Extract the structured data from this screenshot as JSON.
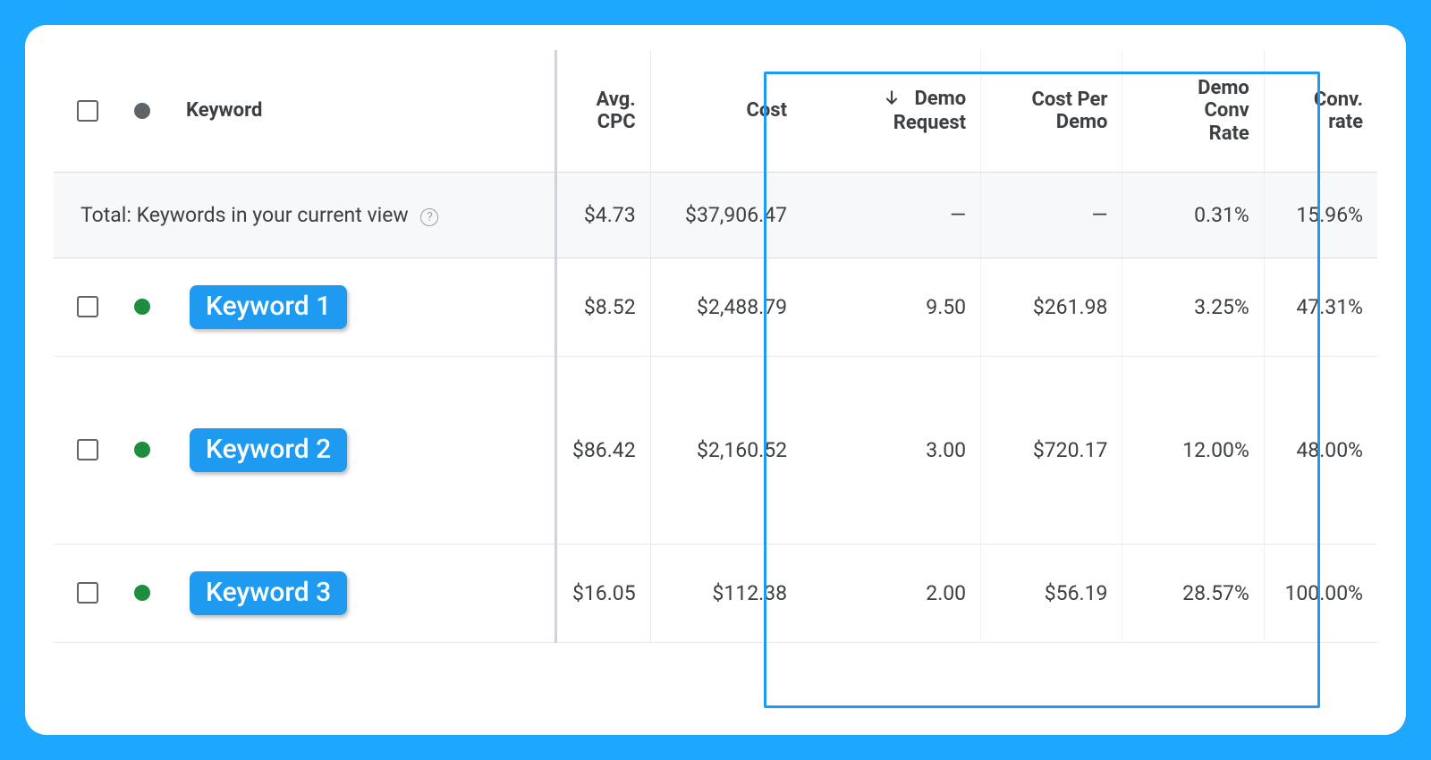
{
  "columns": {
    "keyword": "Keyword",
    "avg_cpc_l1": "Avg.",
    "avg_cpc_l2": "CPC",
    "cost": "Cost",
    "demo_req_l1": "Demo",
    "demo_req_l2": "Request",
    "cpd_l1": "Cost Per",
    "cpd_l2": "Demo",
    "dcr_l1": "Demo",
    "dcr_l2": "Conv",
    "dcr_l3": "Rate",
    "crate_l1": "Conv.",
    "crate_l2": "rate"
  },
  "total": {
    "label": "Total: Keywords in your current view",
    "avg_cpc": "$4.73",
    "cost": "$37,906.47",
    "demo_req": "—",
    "cpd": "—",
    "dcr": "0.31%",
    "crate": "15.96%"
  },
  "rows": [
    {
      "keyword": "Keyword 1",
      "avg_cpc": "$8.52",
      "cost": "$2,488.79",
      "demo_req": "9.50",
      "cpd": "$261.98",
      "dcr": "3.25%",
      "crate": "47.31%"
    },
    {
      "keyword": "Keyword 2",
      "avg_cpc": "$86.42",
      "cost": "$2,160.52",
      "demo_req": "3.00",
      "cpd": "$720.17",
      "dcr": "12.00%",
      "crate": "48.00%"
    },
    {
      "keyword": "Keyword 3",
      "avg_cpc": "$16.05",
      "cost": "$112.38",
      "demo_req": "2.00",
      "cpd": "$56.19",
      "dcr": "28.57%",
      "crate": "100.00%"
    }
  ]
}
